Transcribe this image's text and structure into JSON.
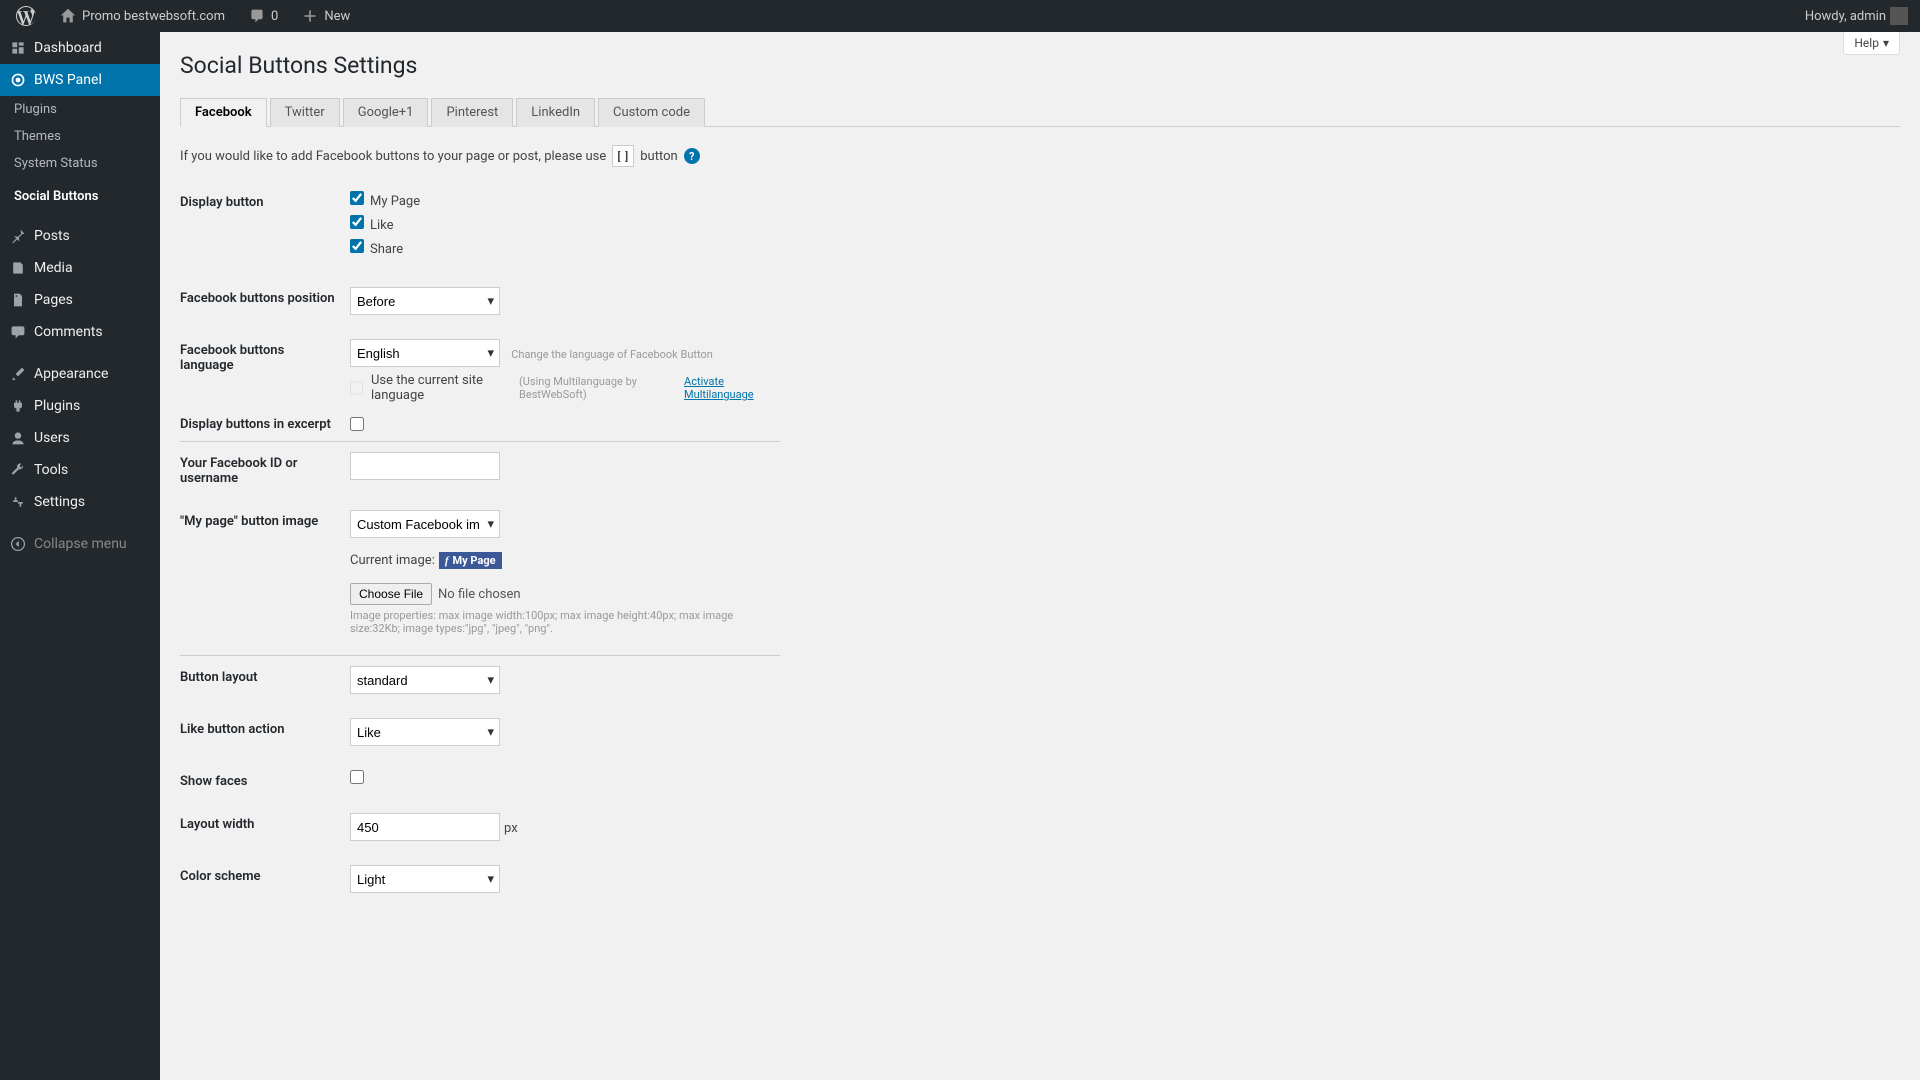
{
  "toolbar": {
    "site_name": "Promo bestwebsoft.com",
    "comments_count": "0",
    "new_label": "New",
    "howdy": "Howdy, admin"
  },
  "sidebar": {
    "dashboard": "Dashboard",
    "bws_panel": "BWS Panel",
    "plugins_sub": "Plugins",
    "themes_sub": "Themes",
    "system_status": "System Status",
    "social_buttons": "Social Buttons",
    "posts": "Posts",
    "media": "Media",
    "pages": "Pages",
    "comments": "Comments",
    "appearance": "Appearance",
    "plugins": "Plugins",
    "users": "Users",
    "tools": "Tools",
    "settings": "Settings",
    "collapse": "Collapse menu"
  },
  "page": {
    "help": "Help",
    "title": "Social Buttons Settings",
    "intro_before": "If you would like to add Facebook buttons to your page or post, please use",
    "intro_after": "button"
  },
  "tabs": {
    "facebook": "Facebook",
    "twitter": "Twitter",
    "google": "Google+1",
    "pinterest": "Pinterest",
    "linkedin": "LinkedIn",
    "custom": "Custom code"
  },
  "form": {
    "display_button": "Display button",
    "my_page": "My Page",
    "like": "Like",
    "share": "Share",
    "fb_position": "Facebook buttons position",
    "position_value": "Before",
    "fb_language": "Facebook buttons language",
    "language_value": "English",
    "lang_hint": "Change the language of Facebook Button",
    "use_site_lang": "Use the current site language",
    "ml_hint": "(Using Multilanguage by BestWebSoft)",
    "ml_link": "Activate Multilanguage",
    "display_excerpt": "Display buttons in excerpt",
    "fb_id": "Your Facebook ID or username",
    "mypage_image": "\"My page\" button image",
    "mypage_value": "Custom Facebook image",
    "current_image": "Current image:",
    "mypage_badge": "My Page",
    "choose_file": "Choose File",
    "no_file": "No file chosen",
    "img_props": "Image properties: max image width:100px; max image height:40px; max image size:32Kb; image types:\"jpg\", \"jpeg\", \"png\".",
    "button_layout": "Button layout",
    "layout_value": "standard",
    "like_action": "Like button action",
    "action_value": "Like",
    "show_faces": "Show faces",
    "layout_width": "Layout width",
    "width_value": "450",
    "px": "px",
    "color_scheme": "Color scheme",
    "scheme_value": "Light"
  }
}
